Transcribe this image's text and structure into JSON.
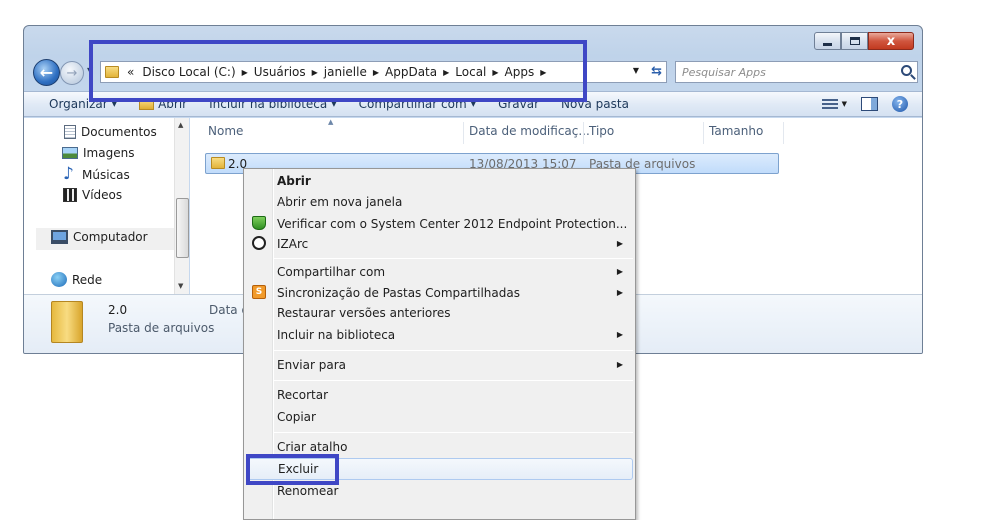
{
  "window": {
    "min_label": "",
    "max_label": "",
    "close_label": "x"
  },
  "address_bar": {
    "overflow": "«",
    "crumbs": [
      "Disco Local (C:)",
      "Usuários",
      "janielle",
      "AppData",
      "Local",
      "Apps"
    ]
  },
  "search": {
    "placeholder": "Pesquisar Apps"
  },
  "toolbar": {
    "organize": "Organizar",
    "open": "Abrir",
    "include": "Incluir na biblioteca",
    "share": "Compartilhar com",
    "burn": "Gravar",
    "new_folder": "Nova pasta"
  },
  "nav_pane": {
    "items": [
      "Documentos",
      "Imagens",
      "Músicas",
      "Vídeos",
      "Computador",
      "Rede"
    ]
  },
  "columns": {
    "name": "Nome",
    "date": "Data de modificaç...",
    "type": "Tipo",
    "size": "Tamanho"
  },
  "files": [
    {
      "name": "2.0",
      "date": "13/08/2013 15:07",
      "type": "Pasta de arquivos"
    }
  ],
  "details": {
    "name": "2.0",
    "type": "Pasta de arquivos",
    "date_label": "Data d"
  },
  "context_menu": {
    "items": [
      "Abrir",
      "Abrir em nova janela",
      "Verificar com o System Center 2012 Endpoint Protection...",
      "IZArc",
      "Compartilhar com",
      "Sincronização de Pastas Compartilhadas",
      "Restaurar versões anteriores",
      "Incluir na biblioteca",
      "Enviar para",
      "Recortar",
      "Copiar",
      "Criar atalho",
      "Excluir",
      "Renomear"
    ]
  },
  "colors": {
    "highlight_box": "#3f47c5",
    "selection": "#c1dcfb"
  }
}
